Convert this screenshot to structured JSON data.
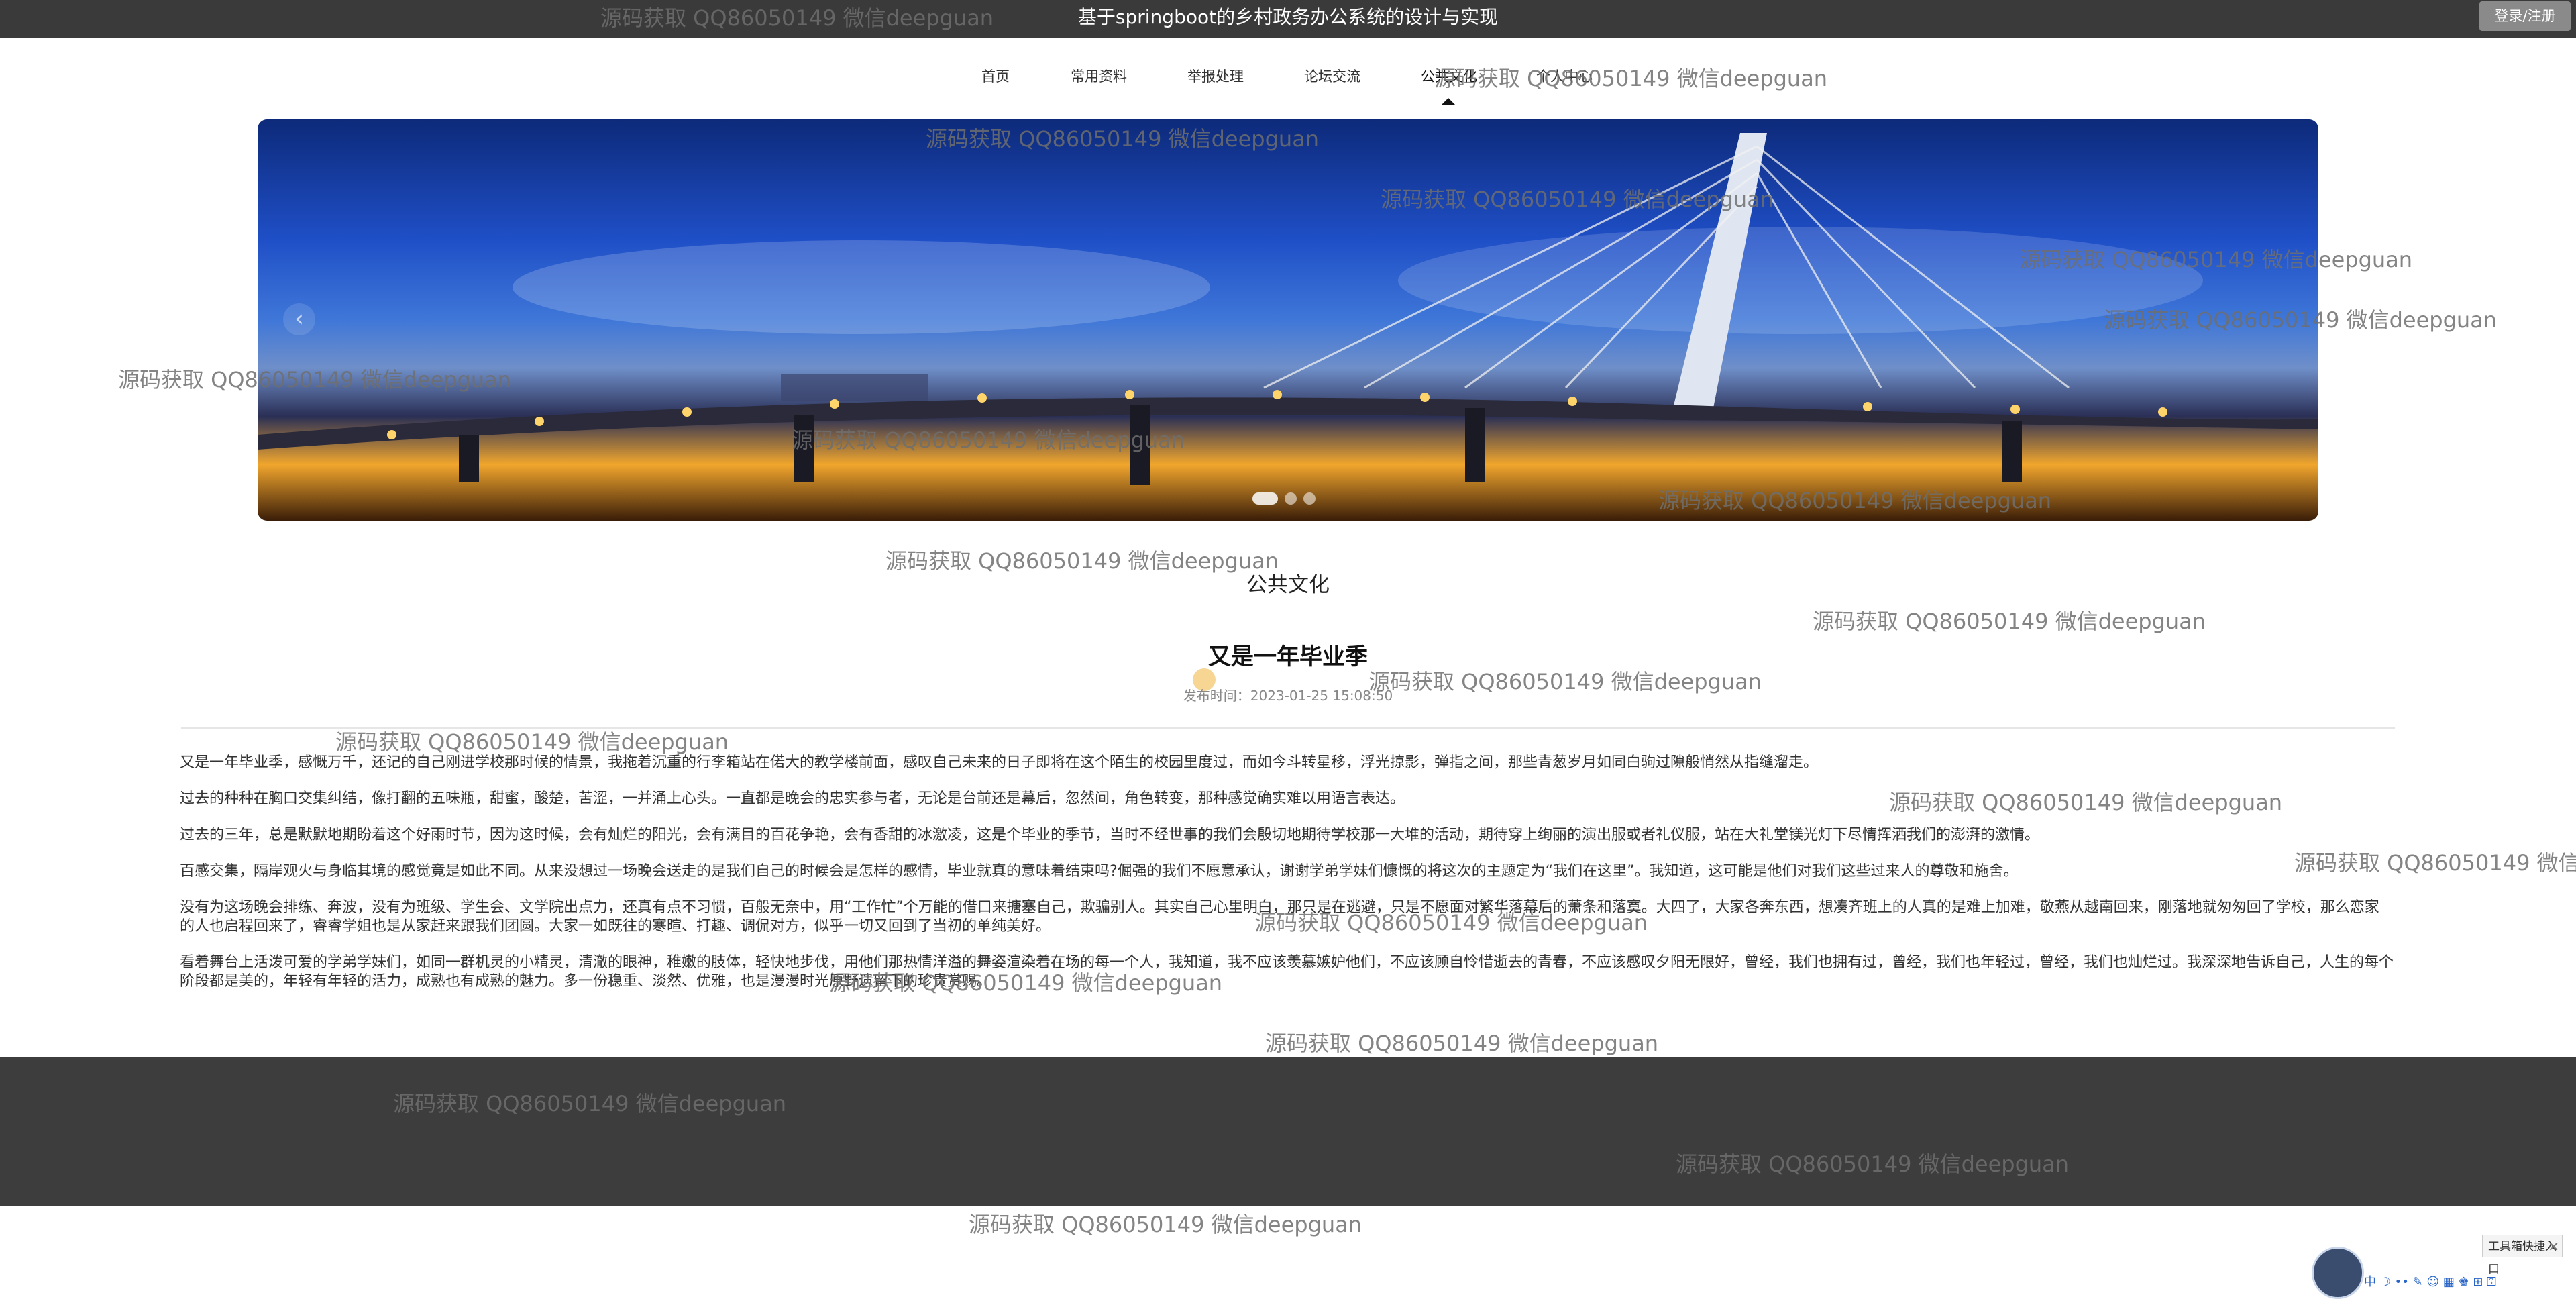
{
  "site_title": "基于springboot的乡村政务办公系统的设计与实现",
  "login_button": "登录/注册",
  "nav": [
    {
      "label": "首页"
    },
    {
      "label": "常用资料"
    },
    {
      "label": "举报处理"
    },
    {
      "label": "论坛交流"
    },
    {
      "label": "公共文化"
    },
    {
      "label": "个人中心"
    }
  ],
  "banner": {
    "prev_arrow": "‹",
    "dots_count": 3,
    "active_dot": 0
  },
  "section_title": "公共文化",
  "article": {
    "title": "又是一年毕业季",
    "publish_time": "发布时间：2023-01-25 15:08:50",
    "paragraphs": [
      "又是一年毕业季，感慨万千，还记的自己刚进学校那时候的情景，我拖着沉重的行李箱站在偌大的教学楼前面，感叹自己未来的日子即将在这个陌生的校园里度过，而如今斗转星移，浮光掠影，弹指之间，那些青葱岁月如同白驹过隙般悄然从指缝溜走。",
      "过去的种种在胸口交集纠结，像打翻的五味瓶，甜蜜，酸楚，苦涩，一并涌上心头。一直都是晚会的忠实参与者，无论是台前还是幕后，忽然间，角色转变，那种感觉确实难以用语言表达。",
      "过去的三年，总是默默地期盼着这个好雨时节，因为这时候，会有灿烂的阳光，会有满目的百花争艳，会有香甜的冰激凌，这是个毕业的季节，当时不经世事的我们会殷切地期待学校那一大堆的活动，期待穿上绚丽的演出服或者礼仪服，站在大礼堂镁光灯下尽情挥洒我们的澎湃的激情。",
      "百感交集，隔岸观火与身临其境的感觉竟是如此不同。从来没想过一场晚会送走的是我们自己的时候会是怎样的感情，毕业就真的意味着结束吗?倔强的我们不愿意承认，谢谢学弟学妹们慷慨的将这次的主题定为“我们在这里”。我知道，这可能是他们对我们这些过来人的尊敬和施舍。",
      "没有为这场晚会排练、奔波，没有为班级、学生会、文学院出点力，还真有点不习惯，百般无奈中，用“工作忙”个万能的借口来搪塞自己，欺骗别人。其实自己心里明白，那只是在逃避，只是不愿面对繁华落幕后的萧条和落寞。大四了，大家各奔东西，想凑齐班上的人真的是难上加难，敬燕从越南回来，刚落地就匆匆回了学校，那么恋家的人也启程回来了，睿睿学姐也是从家赶来跟我们团圆。大家一如既往的寒暄、打趣、调侃对方，似乎一切又回到了当初的单纯美好。",
      "看着舞台上活泼可爱的学弟学妹们，如同一群机灵的小精灵，清澈的眼神，稚嫩的肢体，轻快地步伐，用他们那热情洋溢的舞姿渲染着在场的每一个人，我知道，我不应该羡慕嫉妒他们，不应该顾自怜惜逝去的青春，不应该感叹夕阳无限好，曾经，我们也拥有过，曾经，我们也年轻过，曾经，我们也灿烂过。我深深地告诉自己，人生的每个阶段都是美的，年轻有年轻的活力，成熟也有成熟的魅力。多一份稳重、淡然、优雅，也是漫漫时光原野遗留下的珍贵赏赐。"
    ]
  },
  "watermark_text": "源码获取 QQ86050149 微信deepguan",
  "toolbox": {
    "label": "工具箱快捷入口",
    "close": "✕"
  },
  "widget_icons": "中 ☽ •• ✎ ☺ ▦ ♚ ⊞ ⚿",
  "colors": {
    "topbar": "#3a3a3a",
    "footer": "#3d3d3d",
    "accent": "#111111"
  }
}
